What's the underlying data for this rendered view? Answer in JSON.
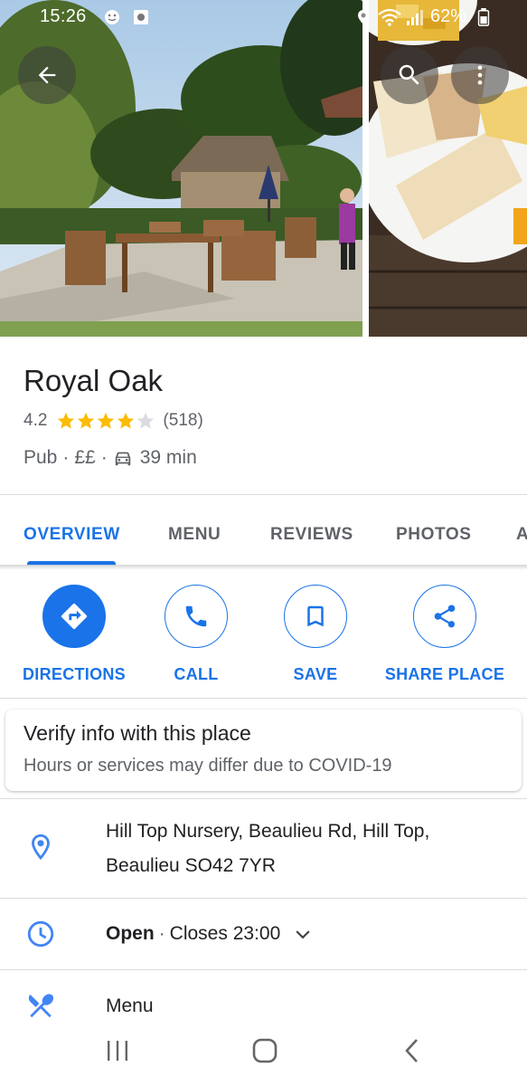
{
  "status_bar": {
    "time": "15:26",
    "battery": "62%"
  },
  "place": {
    "name": "Royal Oak",
    "rating": "4.2",
    "stars": 4.2,
    "review_count": "(518)",
    "category": "Pub",
    "price": "££",
    "drive_time": "39 min"
  },
  "tabs": [
    {
      "label": "OVERVIEW",
      "active": true
    },
    {
      "label": "MENU"
    },
    {
      "label": "REVIEWS"
    },
    {
      "label": "PHOTOS"
    },
    {
      "label": "A"
    }
  ],
  "actions": [
    {
      "label": "DIRECTIONS",
      "icon": "directions-icon"
    },
    {
      "label": "CALL",
      "icon": "phone-icon"
    },
    {
      "label": "SAVE",
      "icon": "bookmark-icon"
    },
    {
      "label": "SHARE PLACE",
      "icon": "share-icon"
    }
  ],
  "covid_card": {
    "title": "Verify info with this place",
    "subtitle": "Hours or services may differ due to COVID-19"
  },
  "info": {
    "address_line1": "Hill Top Nursery, Beaulieu Rd, Hill Top,",
    "address_line2": "Beaulieu SO42 7YR",
    "hours_status": "Open",
    "hours_detail": "Closes 23:00",
    "menu_label": "Menu"
  },
  "colors": {
    "accent": "#1a73e8",
    "star": "#fbbc04",
    "secondary_text": "#5f6368"
  }
}
